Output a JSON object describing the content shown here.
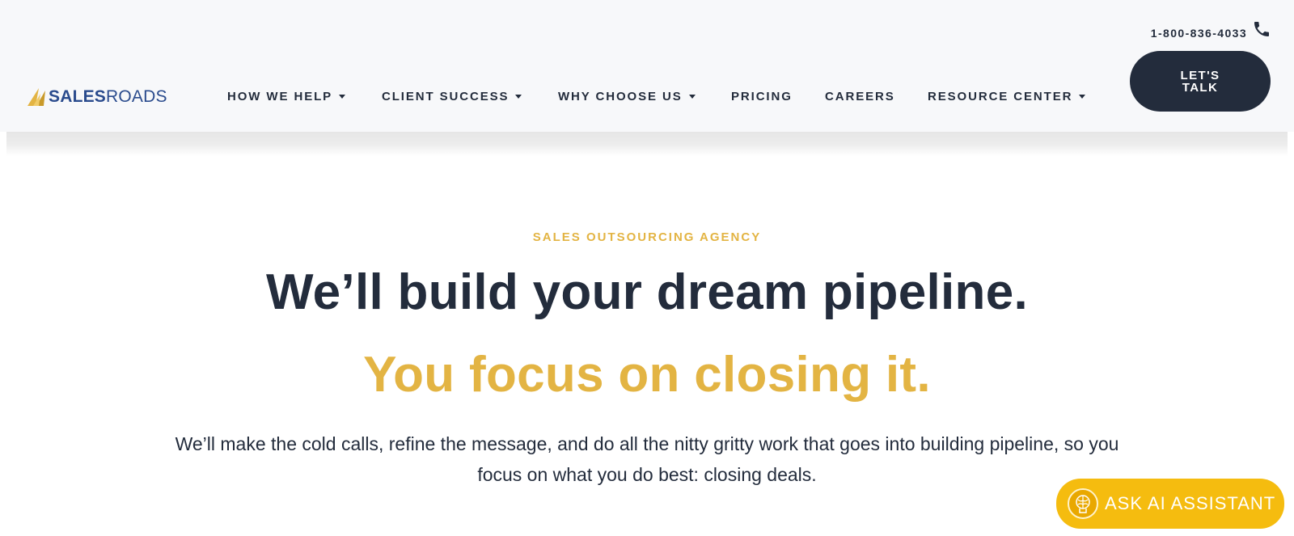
{
  "header": {
    "logo": {
      "word_bold": "SALES",
      "word_light": "ROADS",
      "icon": "sail-logo-icon"
    },
    "phone": {
      "number": "1-800-836-4033",
      "icon": "phone-icon"
    },
    "nav": [
      {
        "label": "HOW WE HELP",
        "has_dropdown": true
      },
      {
        "label": "CLIENT SUCCESS",
        "has_dropdown": true
      },
      {
        "label": "WHY CHOOSE US",
        "has_dropdown": true
      },
      {
        "label": "PRICING",
        "has_dropdown": false
      },
      {
        "label": "CAREERS",
        "has_dropdown": false
      },
      {
        "label": "RESOURCE CENTER",
        "has_dropdown": true
      }
    ],
    "cta_label": "LET'S TALK"
  },
  "hero": {
    "eyebrow": "SALES OUTSOURCING AGENCY",
    "headline": "We’ll build your dream pipeline.",
    "subheadline": "You focus on closing it.",
    "body": "We’ll make the cold calls, refine the message, and do all the nitty gritty work that goes into building pipeline, so you focus on what you do best: closing deals."
  },
  "assistant": {
    "label": "ASK AI ASSISTANT",
    "icon": "ai-brain-icon"
  },
  "colors": {
    "navy": "#232c3c",
    "gold": "#e3b443",
    "button_gold": "#f5bc0f",
    "logo_blue": "#2a4b8d"
  }
}
